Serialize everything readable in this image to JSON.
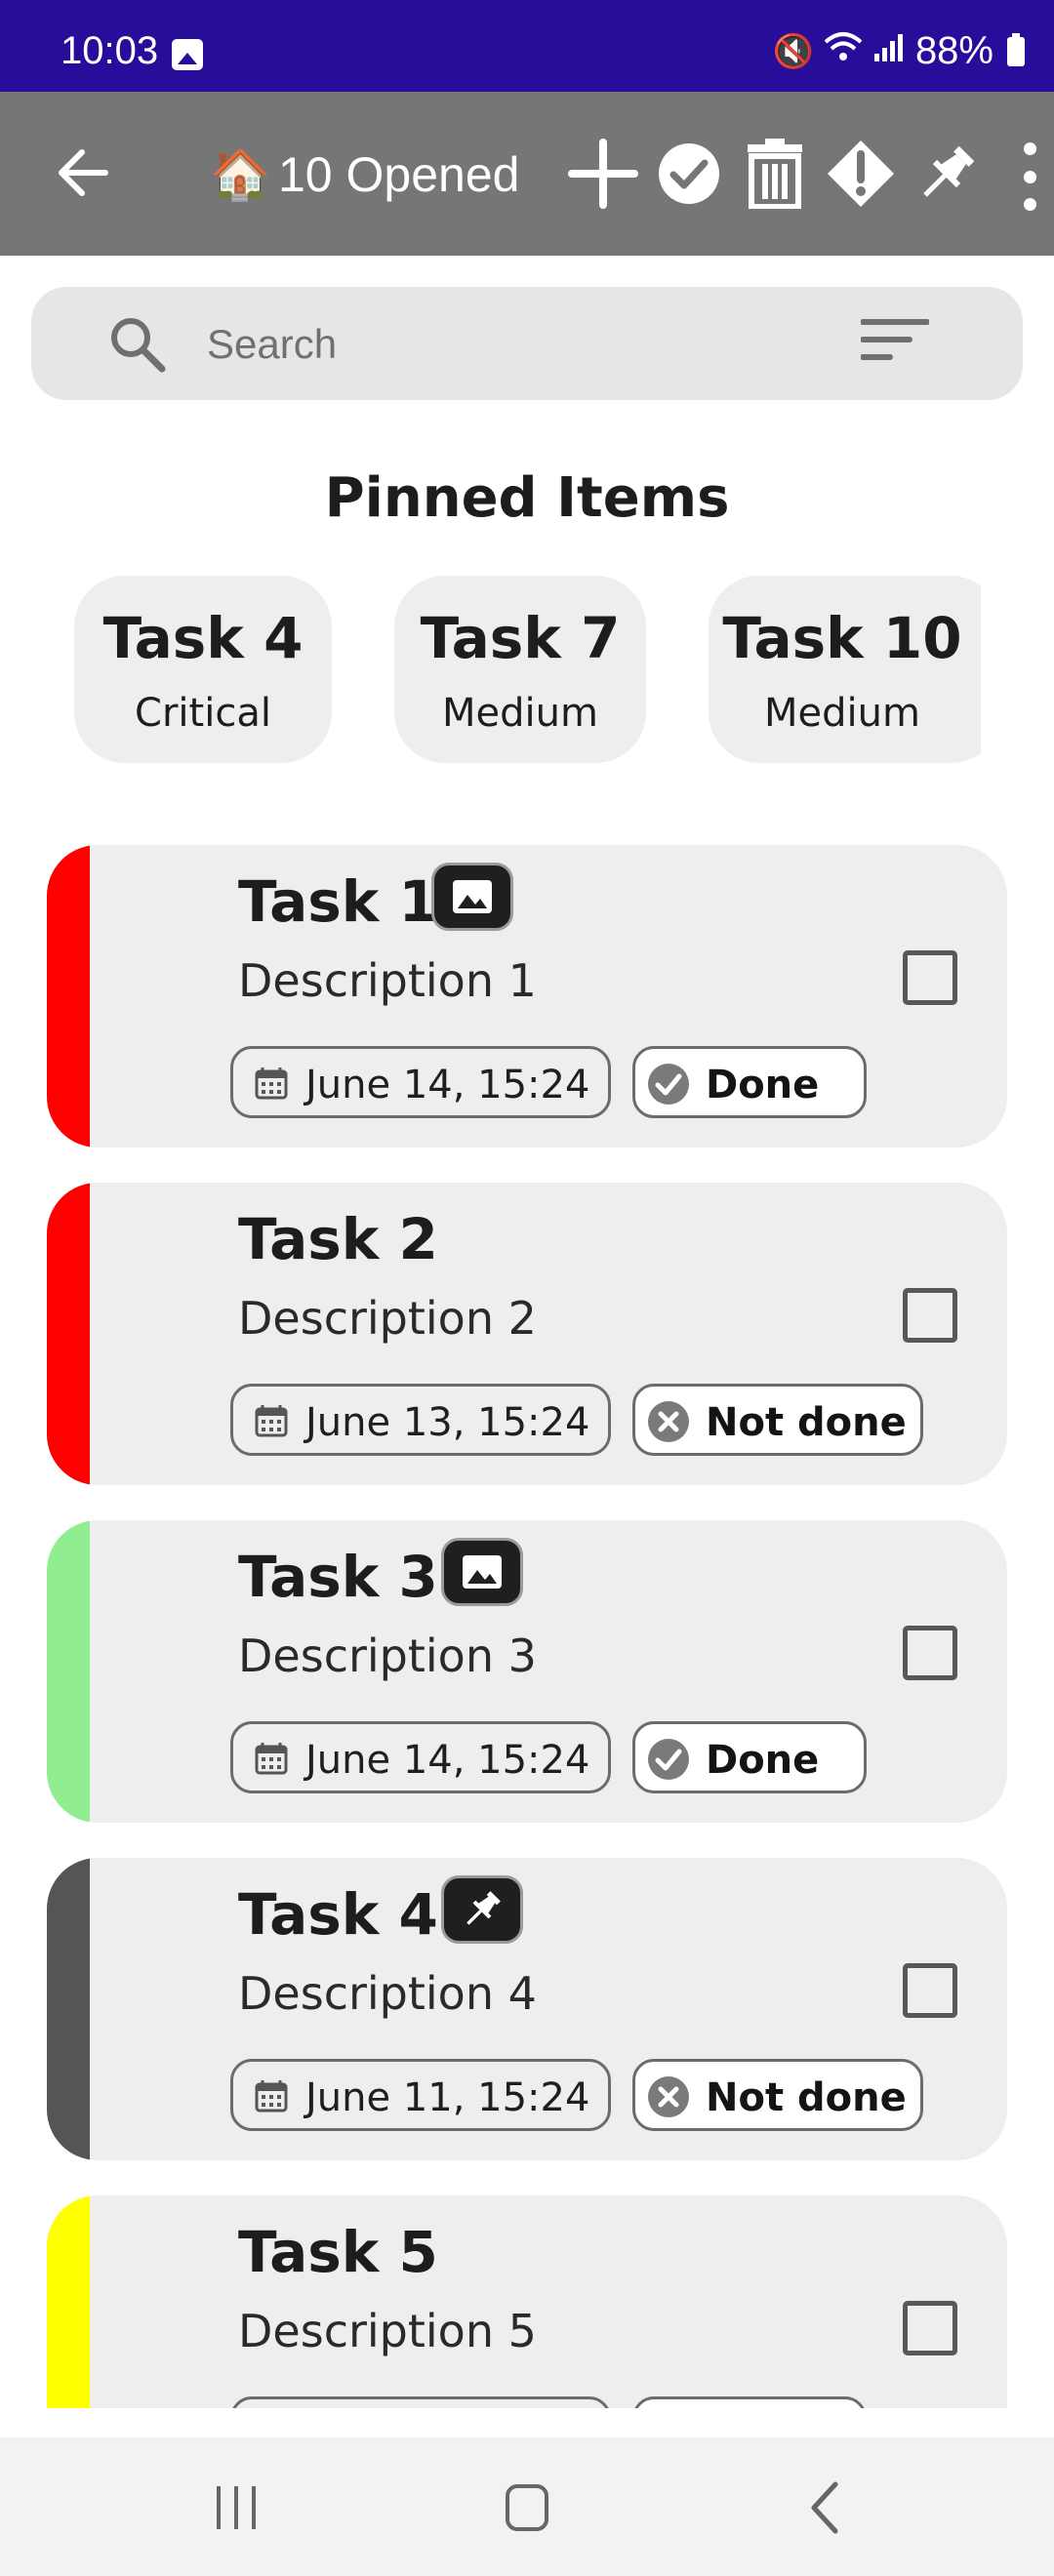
{
  "status_bar": {
    "time": "10:03",
    "battery": "88%"
  },
  "app_bar": {
    "title": "10 Opened",
    "house_icon": "🏠"
  },
  "search": {
    "placeholder": "Search"
  },
  "pinned": {
    "title": "Pinned Items",
    "items": [
      {
        "name": "Task 4",
        "priority": "Critical"
      },
      {
        "name": "Task 7",
        "priority": "Medium"
      },
      {
        "name": "Task 10",
        "priority": "Medium"
      }
    ]
  },
  "tasks": [
    {
      "name": "Task 1",
      "description": "Description 1",
      "date": "June 14, 15:24",
      "status": "Done",
      "color": "#ff0000",
      "badge": "image-icon"
    },
    {
      "name": "Task 2",
      "description": "Description 2",
      "date": "June 13, 15:24",
      "status": "Not done",
      "color": "#ff0000",
      "badge": ""
    },
    {
      "name": "Task 3",
      "description": "Description 3",
      "date": "June 14, 15:24",
      "status": "Done",
      "color": "#90ee90",
      "badge": "image-icon"
    },
    {
      "name": "Task 4",
      "description": "Description 4",
      "date": "June 11, 15:24",
      "status": "Not done",
      "color": "#555555",
      "badge": "pin-icon"
    },
    {
      "name": "Task 5",
      "description": "Description 5",
      "date": "",
      "status": "",
      "color": "#ffff00",
      "badge": ""
    }
  ]
}
